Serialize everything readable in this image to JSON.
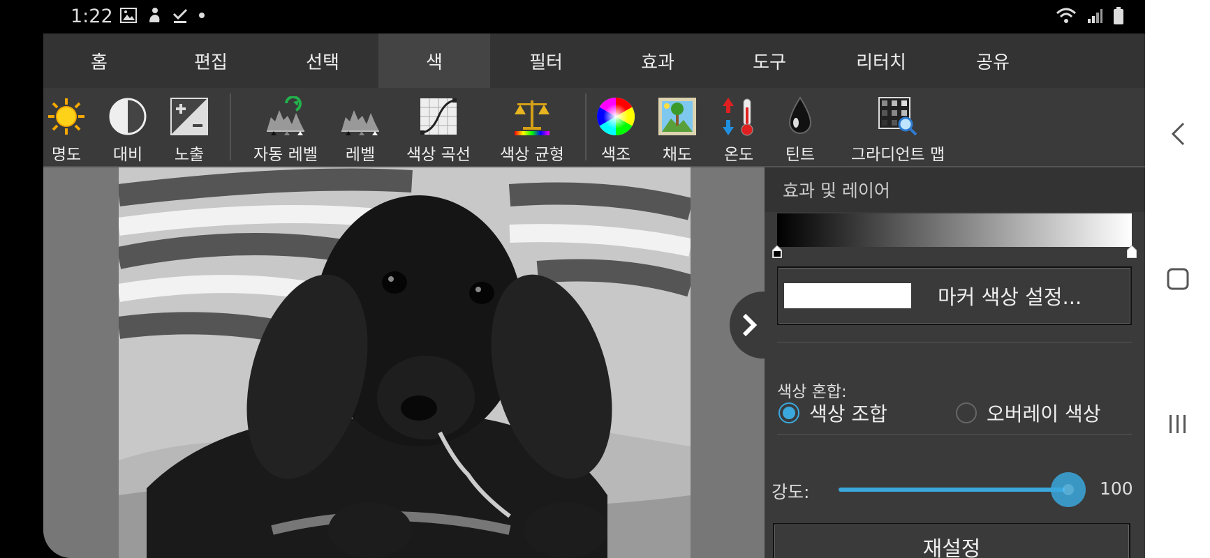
{
  "status": {
    "time": "1:22"
  },
  "menu": {
    "tabs": [
      "홈",
      "편집",
      "선택",
      "색",
      "필터",
      "효과",
      "도구",
      "리터치",
      "공유"
    ],
    "active_index": 3
  },
  "toolbar": {
    "tools": [
      {
        "label": "명도",
        "icon": "brightness-sun-icon"
      },
      {
        "label": "대비",
        "icon": "contrast-icon"
      },
      {
        "label": "노출",
        "icon": "exposure-icon"
      },
      {
        "label": "자동 레벨",
        "icon": "auto-levels-icon"
      },
      {
        "label": "레벨",
        "icon": "levels-icon"
      },
      {
        "label": "색상 곡선",
        "icon": "color-curves-icon"
      },
      {
        "label": "색상 균형",
        "icon": "color-balance-icon"
      },
      {
        "label": "색조",
        "icon": "hue-wheel-icon"
      },
      {
        "label": "채도",
        "icon": "saturation-icon"
      },
      {
        "label": "온도",
        "icon": "temperature-icon"
      },
      {
        "label": "틴트",
        "icon": "tint-drop-icon"
      },
      {
        "label": "그라디언트 맵",
        "icon": "gradient-map-icon"
      }
    ]
  },
  "panel": {
    "title": "효과 및 레이어",
    "gradient": {
      "start_color": "#000000",
      "end_color": "#ffffff"
    },
    "marker_button_label": "마커 색상 설정...",
    "marker_swatch_color": "#ffffff",
    "blend_label": "색상 혼합:",
    "blend_options": [
      {
        "label": "색상 조합",
        "selected": true
      },
      {
        "label": "오버레이 색상",
        "selected": false
      }
    ],
    "strength_label": "강도:",
    "strength_value": "100",
    "reset_label": "재설정",
    "accent_color": "#3aa8dd"
  }
}
